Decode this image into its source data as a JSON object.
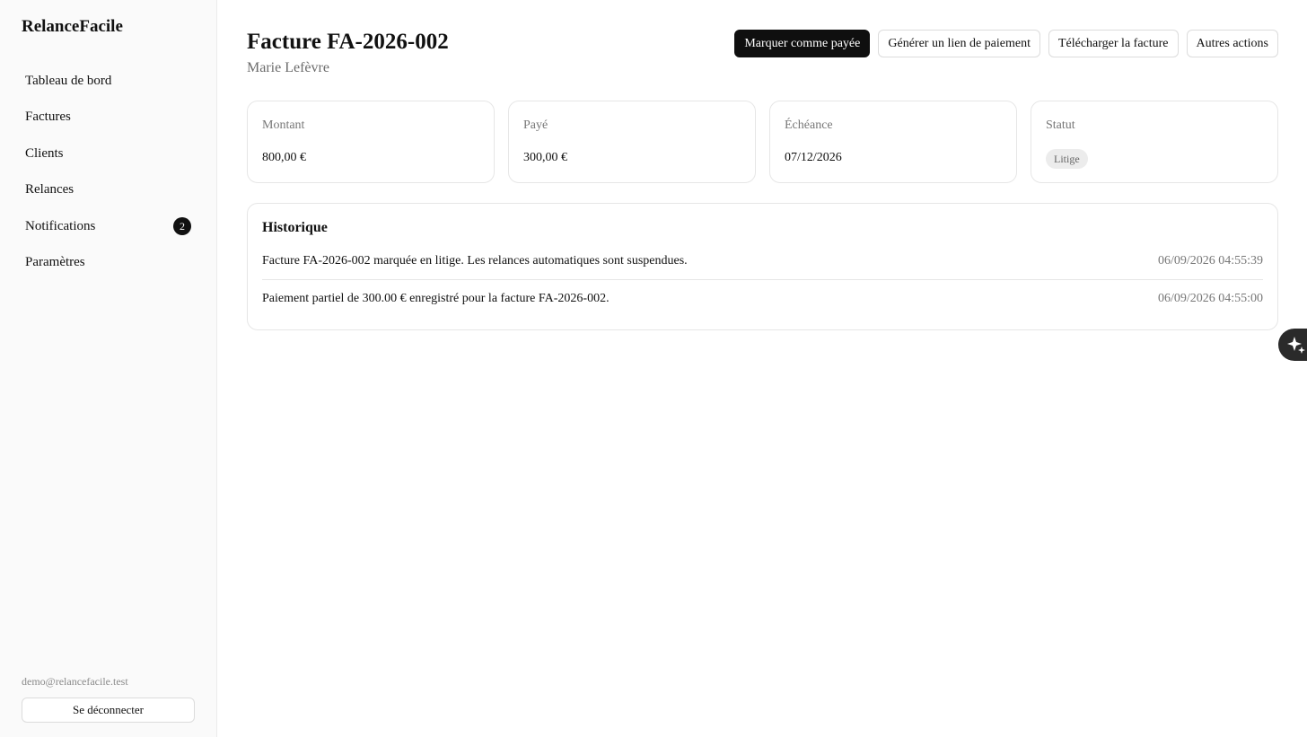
{
  "app": {
    "name": "RelanceFacile"
  },
  "sidebar": {
    "items": [
      {
        "label": "Tableau de bord",
        "badge": ""
      },
      {
        "label": "Factures",
        "badge": ""
      },
      {
        "label": "Clients",
        "badge": ""
      },
      {
        "label": "Relances",
        "badge": ""
      },
      {
        "label": "Notifications",
        "badge": "2"
      },
      {
        "label": "Paramètres",
        "badge": ""
      }
    ],
    "user_email": "demo@relancefacile.test",
    "logout_label": "Se déconnecter"
  },
  "header": {
    "title": "Facture FA-2026-002",
    "subtitle": "Marie Lefèvre",
    "actions": {
      "mark_paid": "Marquer comme payée",
      "payment_link": "Générer un lien de paiement",
      "download": "Télécharger la facture",
      "more": "Autres actions"
    }
  },
  "summary": {
    "amount": {
      "label": "Montant",
      "value": "800,00 €"
    },
    "paid": {
      "label": "Payé",
      "value": "300,00 €"
    },
    "due": {
      "label": "Échéance",
      "value": "07/12/2026"
    },
    "status": {
      "label": "Statut",
      "value": "Litige"
    }
  },
  "history": {
    "title": "Historique",
    "entries": [
      {
        "text": "Facture FA-2026-002 marquée en litige. Les relances automatiques sont suspendues.",
        "timestamp": "06/09/2026 04:55:39"
      },
      {
        "text": "Paiement partiel de 300.00 € enregistré pour la facture FA-2026-002.",
        "timestamp": "06/09/2026 04:55:00"
      }
    ]
  },
  "icons": {
    "assistant": "sparkles-icon"
  },
  "colors": {
    "primary": "#0f0f0f",
    "sidebar_bg": "#fafafa",
    "badge_bg": "#ececec"
  }
}
